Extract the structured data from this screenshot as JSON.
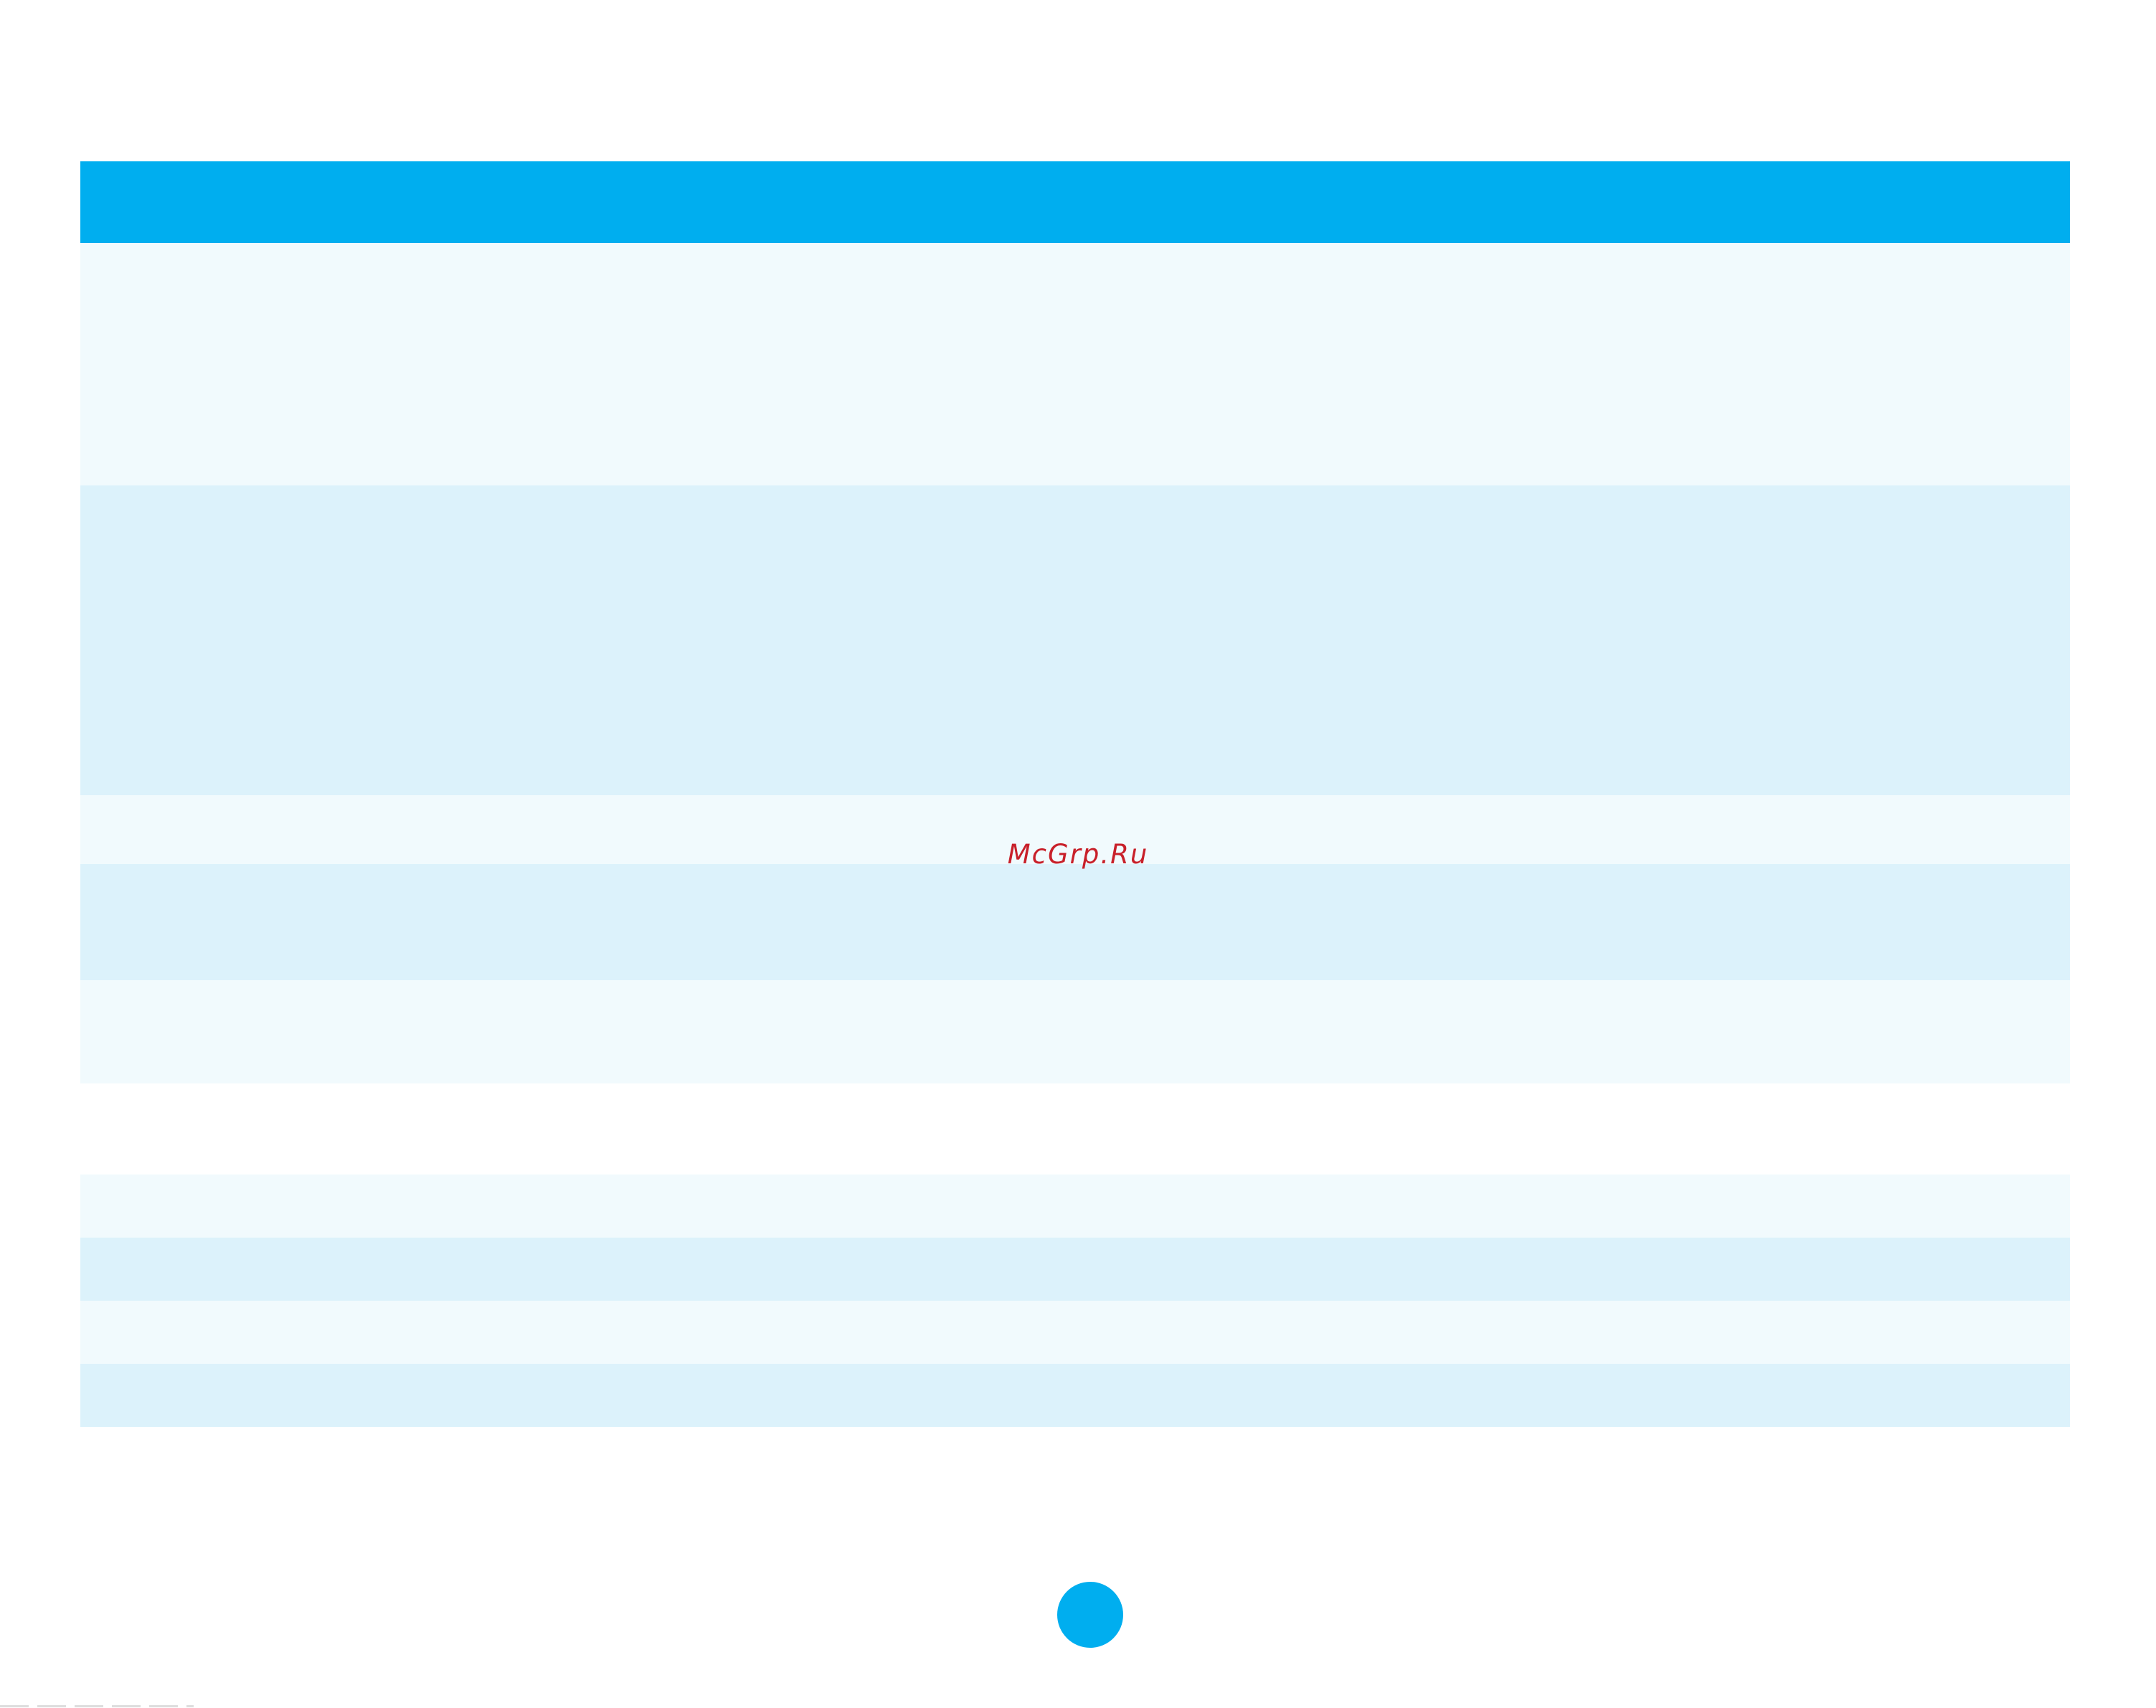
{
  "page": {
    "watermark": "McGrp.Ru",
    "accent_color": "#00aeef",
    "row_color_light": "#f1fafd",
    "row_color_mid": "#dcf2fb",
    "watermark_color": "#c8202a"
  },
  "table_top": {
    "header": "",
    "rows": [
      "",
      "",
      "",
      "",
      ""
    ]
  },
  "table_bottom": {
    "rows": [
      "",
      "",
      "",
      ""
    ]
  },
  "page_number": ""
}
